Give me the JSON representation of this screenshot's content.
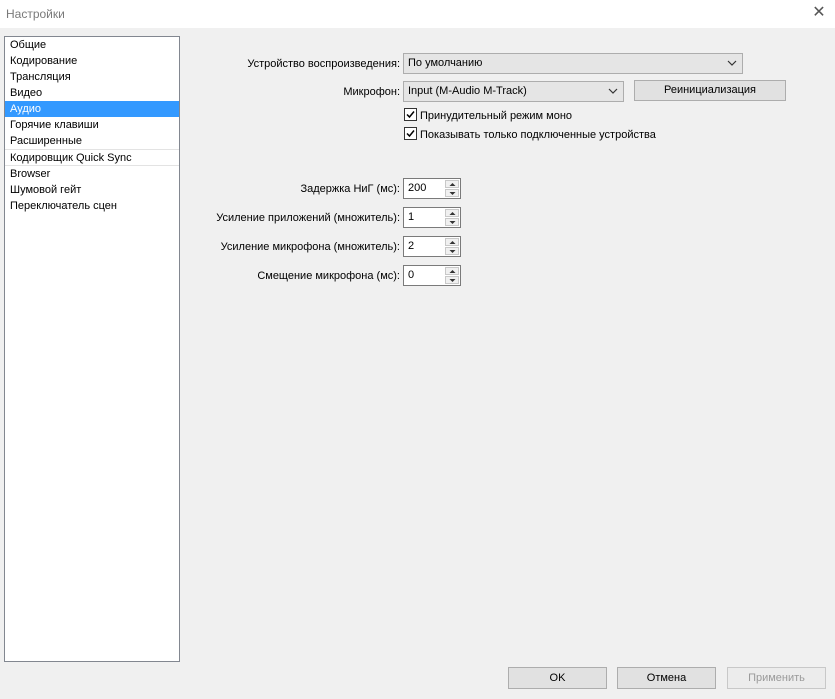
{
  "window": {
    "title": "Настройки",
    "close_symbol": "✕"
  },
  "sidebar": {
    "items": [
      {
        "label": "Общие"
      },
      {
        "label": "Кодирование"
      },
      {
        "label": "Трансляция"
      },
      {
        "label": "Видео"
      },
      {
        "label": "Аудио",
        "selected": true
      },
      {
        "label": "Горячие клавиши"
      },
      {
        "label": "Расширенные"
      },
      {
        "label": "Кодировщик Quick Sync"
      },
      {
        "label": "Browser"
      },
      {
        "label": "Шумовой гейт"
      },
      {
        "label": "Переключатель сцен"
      }
    ]
  },
  "audio": {
    "playback_device": {
      "label": "Устройство воспроизведения:",
      "value": "По умолчанию"
    },
    "microphone": {
      "label": "Микрофон:",
      "value": "Input (M-Audio M-Track)"
    },
    "reinit_button": "Реинициализация",
    "force_mono": {
      "label": "Принудительный режим моно",
      "checked": true
    },
    "show_connected_only": {
      "label": "Показывать только подключенные устройства",
      "checked": true
    },
    "latency": {
      "label": "Задержка НиГ (мс):",
      "value": "200"
    },
    "app_gain": {
      "label": "Усиление приложений (множитель):",
      "value": "1"
    },
    "mic_gain": {
      "label": "Усиление микрофона (множитель):",
      "value": "2"
    },
    "mic_offset": {
      "label": "Смещение микрофона (мс):",
      "value": "0"
    }
  },
  "footer": {
    "ok": "OK",
    "cancel": "Отмена",
    "apply": "Применить"
  }
}
